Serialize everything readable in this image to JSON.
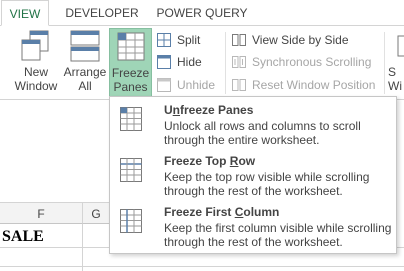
{
  "tabs": [
    {
      "label": "VIEW",
      "active": true
    },
    {
      "label": "DEVELOPER",
      "active": false
    },
    {
      "label": "POWER QUERY",
      "active": false
    }
  ],
  "ribbon": {
    "new_window": {
      "line1": "New",
      "line2": "Window"
    },
    "arrange_all": {
      "line1": "Arrange",
      "line2": "All"
    },
    "freeze_panes": {
      "line1": "Freeze",
      "line2": "Panes",
      "caret": "▾"
    },
    "split": "Split",
    "hide": "Hide",
    "unhide": "Unhide",
    "view_side_by_side": "View Side by Side",
    "synchronous_scrolling": "Synchronous Scrolling",
    "reset_window_position": "Reset Window Position",
    "switch_windows": {
      "line1": "S",
      "line2": "Wi"
    }
  },
  "menu": {
    "items": [
      {
        "title_u": "n",
        "title_pre": "U",
        "title_post": "freeze Panes",
        "desc": "Unlock all rows and columns to scroll through the entire worksheet."
      },
      {
        "title_pre": "Freeze Top ",
        "title_u": "R",
        "title_post": "ow",
        "desc": "Keep the top row visible while scrolling through the rest of the worksheet."
      },
      {
        "title_pre": "Freeze First ",
        "title_u": "C",
        "title_post": "olumn",
        "desc": "Keep the first column visible while scrolling through the rest of the worksheet."
      }
    ]
  },
  "sheet": {
    "columns": [
      "F",
      "G"
    ],
    "cell_text": "SALE"
  },
  "colors": {
    "accent": "#217346",
    "pressed": "#9fd5b7",
    "disabled": "#a6a6a6"
  }
}
